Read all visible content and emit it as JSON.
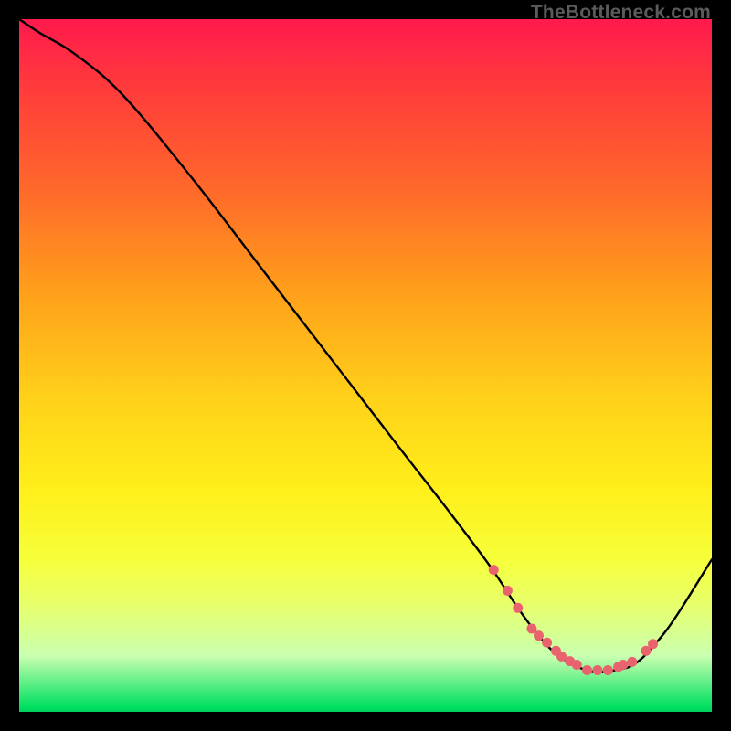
{
  "watermark": "TheBottleneck.com",
  "colors": {
    "curve_stroke": "#000000",
    "dot_fill": "#e9636f"
  },
  "chart_data": {
    "type": "line",
    "title": "",
    "xlabel": "",
    "ylabel": "",
    "xlim": [
      0,
      100
    ],
    "ylim": [
      0,
      100
    ],
    "series": [
      {
        "name": "bottleneck-curve",
        "x": [
          0,
          3,
          8,
          15,
          25,
          35,
          45,
          55,
          62,
          68,
          72,
          75,
          78,
          82,
          86,
          89,
          92,
          95,
          100
        ],
        "y": [
          100,
          98,
          95,
          89,
          77,
          64,
          51,
          38,
          29,
          21,
          15,
          11,
          8,
          6,
          6,
          7,
          10,
          14,
          22
        ]
      }
    ],
    "marker_points": {
      "name": "highlight-dots",
      "x": [
        68.5,
        70.5,
        72,
        74,
        75,
        76.2,
        77.5,
        78.3,
        79.5,
        80.5,
        82,
        83.5,
        85,
        86.5,
        87.2,
        88.5,
        90.5,
        91.5
      ],
      "y": [
        20.5,
        17.5,
        15,
        12,
        11,
        10,
        8.8,
        8,
        7.3,
        6.8,
        6,
        6,
        6,
        6.5,
        6.8,
        7.2,
        8.8,
        9.8
      ]
    }
  }
}
